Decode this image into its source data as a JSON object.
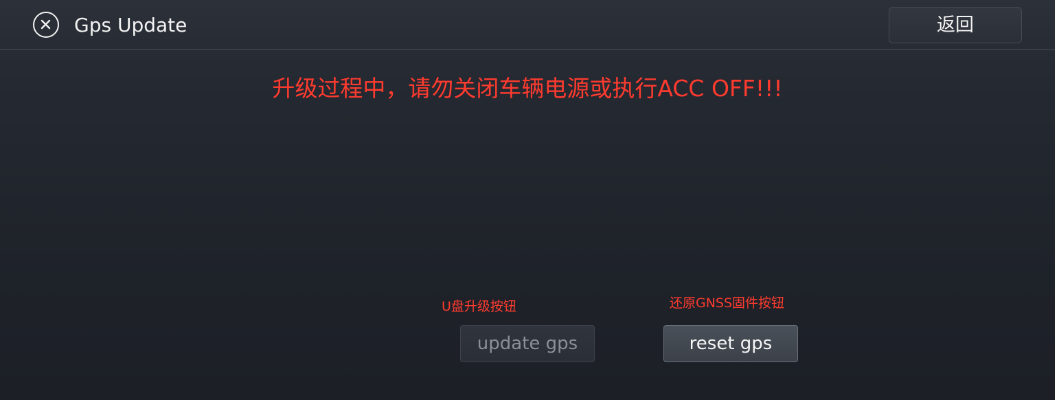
{
  "header": {
    "title": "Gps Update",
    "close_icon": "close-circle-icon",
    "back_label": "返回"
  },
  "warning": {
    "text": "升级过程中，请勿关闭车辆电源或执行ACC OFF!!!"
  },
  "actions": {
    "update": {
      "hint": "U盘升级按钮",
      "label": "update gps",
      "state": "disabled"
    },
    "reset": {
      "hint": "还原GNSS固件按钮",
      "label": "reset gps",
      "state": "enabled"
    }
  },
  "colors": {
    "warning": "#ff3b2f",
    "background": "#22262d",
    "text": "#f2f2f2"
  }
}
